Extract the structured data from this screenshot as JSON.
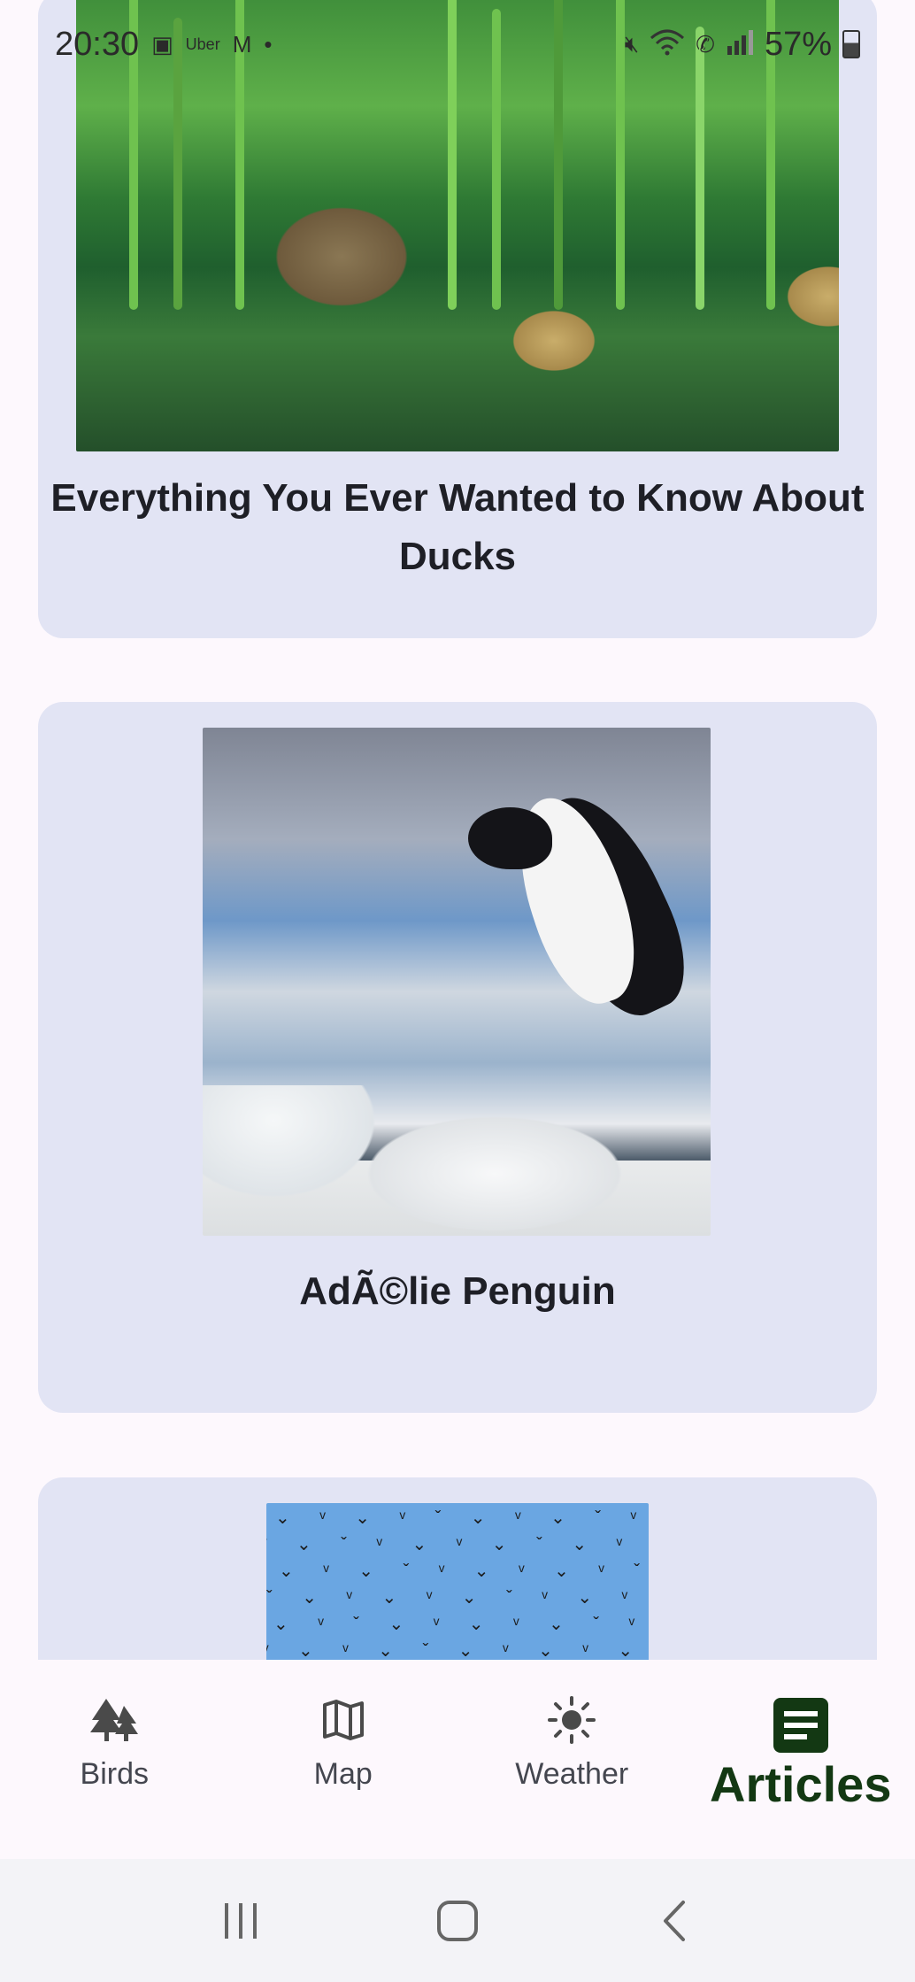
{
  "status_bar": {
    "time": "20:30",
    "left_icons": [
      "gallery-icon",
      "uber-icon",
      "gmail-icon",
      "dot-icon"
    ],
    "uber_text": "Uber",
    "right_icons": [
      "mute-icon",
      "wifi-icon",
      "call-icon",
      "signal-icon"
    ],
    "battery": "57%"
  },
  "articles": [
    {
      "title": "Everything You Ever Wanted to Know About Ducks",
      "image": "duck-image"
    },
    {
      "title": "AdÃ©lie Penguin",
      "image": "penguin-image"
    },
    {
      "title": "",
      "image": "birds-flock-image"
    }
  ],
  "bottom_nav": {
    "items": [
      {
        "label": "Birds",
        "icon": "trees-icon"
      },
      {
        "label": "Map",
        "icon": "map-icon"
      },
      {
        "label": "Weather",
        "icon": "sun-icon"
      },
      {
        "label": "Articles",
        "icon": "article-icon",
        "active": true
      }
    ]
  },
  "system_nav": [
    "recents-button",
    "home-button",
    "back-button"
  ],
  "colors": {
    "card_bg": "#e2e4f4",
    "page_bg": "#fdf8fd",
    "active_nav": "#133813",
    "inactive_nav": "#44464f"
  }
}
